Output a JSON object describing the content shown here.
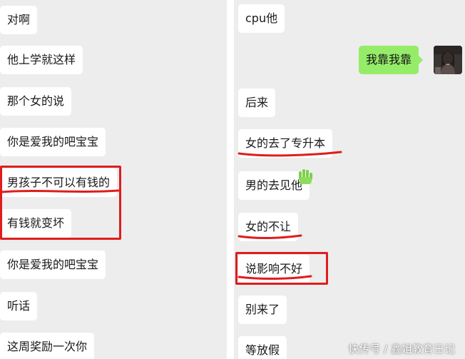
{
  "left_chat": {
    "messages": [
      {
        "text": "对啊"
      },
      {
        "text": "他上学就这样"
      },
      {
        "text": "那个女的说"
      },
      {
        "text": "你是爱我的吧宝宝"
      },
      {
        "text": "男孩子不可以有钱的"
      },
      {
        "text": "有钱就变坏"
      },
      {
        "text": "你是爱我的吧宝宝"
      },
      {
        "text": "听话"
      },
      {
        "text": "这周奖励一次你"
      }
    ]
  },
  "right_chat": {
    "messages": [
      {
        "text": "cpu他"
      },
      {
        "text": "我靠我靠",
        "sent": true
      },
      {
        "text": "后来"
      },
      {
        "text": "女的去了专升本"
      },
      {
        "text": "男的去见他"
      },
      {
        "text": "女的不让"
      },
      {
        "text": "说影响不好"
      },
      {
        "text": "别来了"
      },
      {
        "text": "等放假"
      }
    ],
    "avatar_icon": "profile-photo-avatar"
  },
  "colors": {
    "chat_background": "#ededed",
    "received_bubble": "#ffffff",
    "sent_bubble": "#95ec69",
    "highlight_red": "#e01c1c",
    "text": "#191919"
  },
  "watermark": {
    "text": "快传号 / 鑫姐教育日记"
  }
}
